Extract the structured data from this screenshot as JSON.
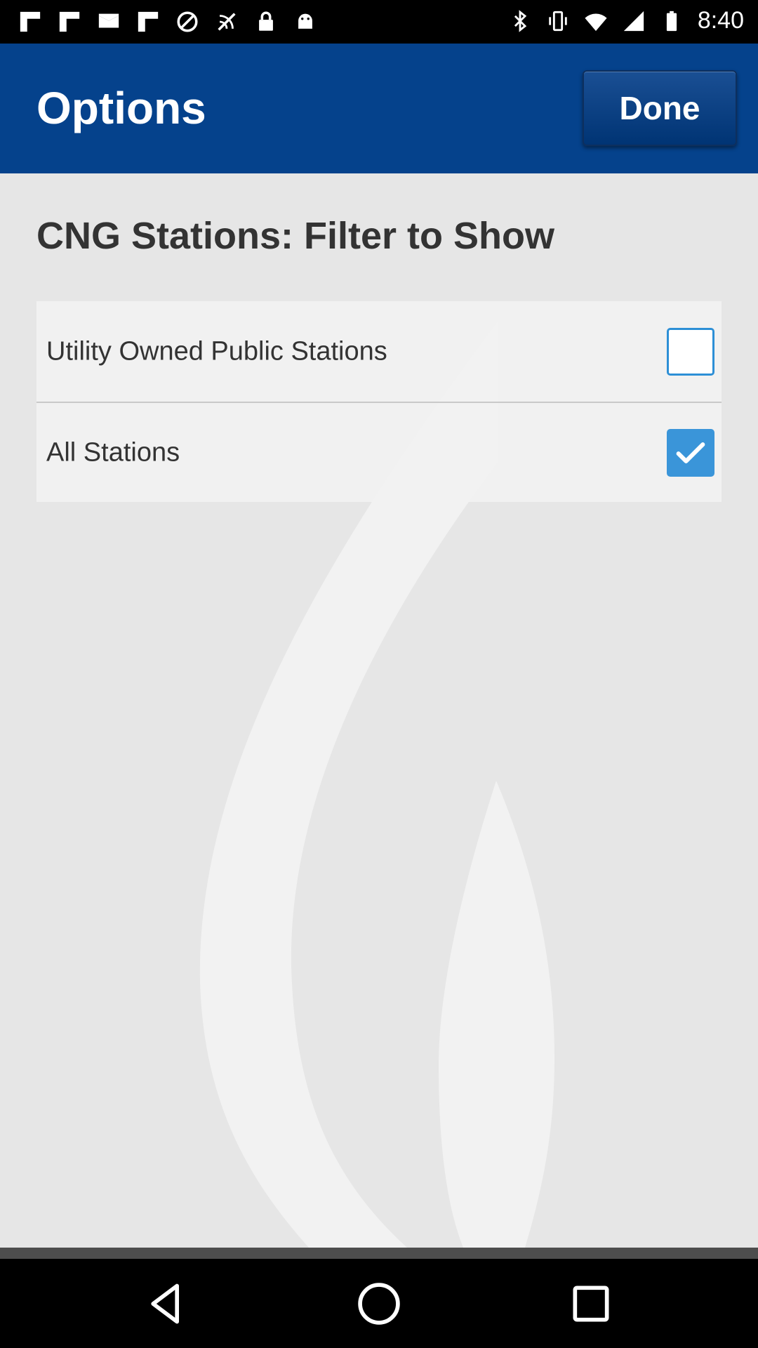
{
  "status_bar": {
    "time": "8:40",
    "left_icons": [
      "flipboard-icon",
      "flipboard-icon",
      "email-icon",
      "flipboard-icon",
      "blocked-icon",
      "no-signal-icon",
      "lock-icon",
      "android-icon"
    ],
    "right_icons": [
      "bluetooth-icon",
      "vibrate-icon",
      "wifi-icon",
      "signal-icon",
      "battery-icon"
    ]
  },
  "header": {
    "title": "Options",
    "done_label": "Done",
    "background_color": "#05428c"
  },
  "section": {
    "title": "CNG Stations: Filter to Show"
  },
  "options": [
    {
      "label": "Utility Owned Public Stations",
      "checked": false
    },
    {
      "label": "All Stations",
      "checked": true
    }
  ],
  "colors": {
    "accent": "#3a95d9",
    "content_background": "#e6e6e6"
  },
  "nav_bar": {
    "buttons": [
      "back-icon",
      "home-icon",
      "recents-icon"
    ]
  }
}
